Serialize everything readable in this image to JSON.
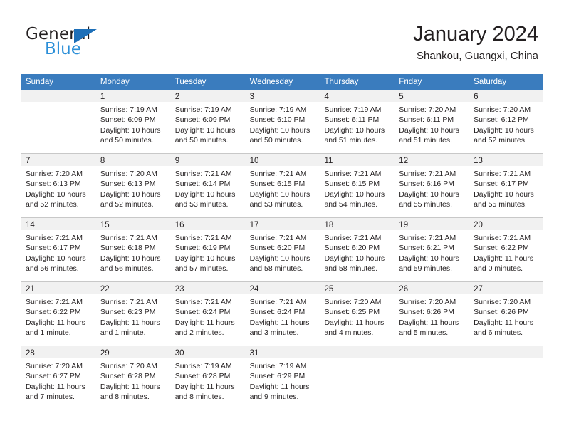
{
  "brand": {
    "name_part1": "General",
    "name_part2": "Blue",
    "accent_color": "#2b8fd8",
    "triangle_color": "#1d6fb8"
  },
  "header": {
    "title": "January 2024",
    "subtitle": "Shankou, Guangxi, China"
  },
  "calendar": {
    "header_bg": "#3a7cbe",
    "daynum_strip_bg": "#f1f1f1",
    "weekday_headers": [
      "Sunday",
      "Monday",
      "Tuesday",
      "Wednesday",
      "Thursday",
      "Friday",
      "Saturday"
    ],
    "weeks": [
      [
        {
          "day": "",
          "lines": []
        },
        {
          "day": "1",
          "lines": [
            "Sunrise: 7:19 AM",
            "Sunset: 6:09 PM",
            "Daylight: 10 hours",
            "and 50 minutes."
          ]
        },
        {
          "day": "2",
          "lines": [
            "Sunrise: 7:19 AM",
            "Sunset: 6:09 PM",
            "Daylight: 10 hours",
            "and 50 minutes."
          ]
        },
        {
          "day": "3",
          "lines": [
            "Sunrise: 7:19 AM",
            "Sunset: 6:10 PM",
            "Daylight: 10 hours",
            "and 50 minutes."
          ]
        },
        {
          "day": "4",
          "lines": [
            "Sunrise: 7:19 AM",
            "Sunset: 6:11 PM",
            "Daylight: 10 hours",
            "and 51 minutes."
          ]
        },
        {
          "day": "5",
          "lines": [
            "Sunrise: 7:20 AM",
            "Sunset: 6:11 PM",
            "Daylight: 10 hours",
            "and 51 minutes."
          ]
        },
        {
          "day": "6",
          "lines": [
            "Sunrise: 7:20 AM",
            "Sunset: 6:12 PM",
            "Daylight: 10 hours",
            "and 52 minutes."
          ]
        }
      ],
      [
        {
          "day": "7",
          "lines": [
            "Sunrise: 7:20 AM",
            "Sunset: 6:13 PM",
            "Daylight: 10 hours",
            "and 52 minutes."
          ]
        },
        {
          "day": "8",
          "lines": [
            "Sunrise: 7:20 AM",
            "Sunset: 6:13 PM",
            "Daylight: 10 hours",
            "and 52 minutes."
          ]
        },
        {
          "day": "9",
          "lines": [
            "Sunrise: 7:21 AM",
            "Sunset: 6:14 PM",
            "Daylight: 10 hours",
            "and 53 minutes."
          ]
        },
        {
          "day": "10",
          "lines": [
            "Sunrise: 7:21 AM",
            "Sunset: 6:15 PM",
            "Daylight: 10 hours",
            "and 53 minutes."
          ]
        },
        {
          "day": "11",
          "lines": [
            "Sunrise: 7:21 AM",
            "Sunset: 6:15 PM",
            "Daylight: 10 hours",
            "and 54 minutes."
          ]
        },
        {
          "day": "12",
          "lines": [
            "Sunrise: 7:21 AM",
            "Sunset: 6:16 PM",
            "Daylight: 10 hours",
            "and 55 minutes."
          ]
        },
        {
          "day": "13",
          "lines": [
            "Sunrise: 7:21 AM",
            "Sunset: 6:17 PM",
            "Daylight: 10 hours",
            "and 55 minutes."
          ]
        }
      ],
      [
        {
          "day": "14",
          "lines": [
            "Sunrise: 7:21 AM",
            "Sunset: 6:17 PM",
            "Daylight: 10 hours",
            "and 56 minutes."
          ]
        },
        {
          "day": "15",
          "lines": [
            "Sunrise: 7:21 AM",
            "Sunset: 6:18 PM",
            "Daylight: 10 hours",
            "and 56 minutes."
          ]
        },
        {
          "day": "16",
          "lines": [
            "Sunrise: 7:21 AM",
            "Sunset: 6:19 PM",
            "Daylight: 10 hours",
            "and 57 minutes."
          ]
        },
        {
          "day": "17",
          "lines": [
            "Sunrise: 7:21 AM",
            "Sunset: 6:20 PM",
            "Daylight: 10 hours",
            "and 58 minutes."
          ]
        },
        {
          "day": "18",
          "lines": [
            "Sunrise: 7:21 AM",
            "Sunset: 6:20 PM",
            "Daylight: 10 hours",
            "and 58 minutes."
          ]
        },
        {
          "day": "19",
          "lines": [
            "Sunrise: 7:21 AM",
            "Sunset: 6:21 PM",
            "Daylight: 10 hours",
            "and 59 minutes."
          ]
        },
        {
          "day": "20",
          "lines": [
            "Sunrise: 7:21 AM",
            "Sunset: 6:22 PM",
            "Daylight: 11 hours",
            "and 0 minutes."
          ]
        }
      ],
      [
        {
          "day": "21",
          "lines": [
            "Sunrise: 7:21 AM",
            "Sunset: 6:22 PM",
            "Daylight: 11 hours",
            "and 1 minute."
          ]
        },
        {
          "day": "22",
          "lines": [
            "Sunrise: 7:21 AM",
            "Sunset: 6:23 PM",
            "Daylight: 11 hours",
            "and 1 minute."
          ]
        },
        {
          "day": "23",
          "lines": [
            "Sunrise: 7:21 AM",
            "Sunset: 6:24 PM",
            "Daylight: 11 hours",
            "and 2 minutes."
          ]
        },
        {
          "day": "24",
          "lines": [
            "Sunrise: 7:21 AM",
            "Sunset: 6:24 PM",
            "Daylight: 11 hours",
            "and 3 minutes."
          ]
        },
        {
          "day": "25",
          "lines": [
            "Sunrise: 7:20 AM",
            "Sunset: 6:25 PM",
            "Daylight: 11 hours",
            "and 4 minutes."
          ]
        },
        {
          "day": "26",
          "lines": [
            "Sunrise: 7:20 AM",
            "Sunset: 6:26 PM",
            "Daylight: 11 hours",
            "and 5 minutes."
          ]
        },
        {
          "day": "27",
          "lines": [
            "Sunrise: 7:20 AM",
            "Sunset: 6:26 PM",
            "Daylight: 11 hours",
            "and 6 minutes."
          ]
        }
      ],
      [
        {
          "day": "28",
          "lines": [
            "Sunrise: 7:20 AM",
            "Sunset: 6:27 PM",
            "Daylight: 11 hours",
            "and 7 minutes."
          ]
        },
        {
          "day": "29",
          "lines": [
            "Sunrise: 7:20 AM",
            "Sunset: 6:28 PM",
            "Daylight: 11 hours",
            "and 8 minutes."
          ]
        },
        {
          "day": "30",
          "lines": [
            "Sunrise: 7:19 AM",
            "Sunset: 6:28 PM",
            "Daylight: 11 hours",
            "and 8 minutes."
          ]
        },
        {
          "day": "31",
          "lines": [
            "Sunrise: 7:19 AM",
            "Sunset: 6:29 PM",
            "Daylight: 11 hours",
            "and 9 minutes."
          ]
        },
        {
          "day": "",
          "lines": []
        },
        {
          "day": "",
          "lines": []
        },
        {
          "day": "",
          "lines": []
        }
      ]
    ]
  }
}
